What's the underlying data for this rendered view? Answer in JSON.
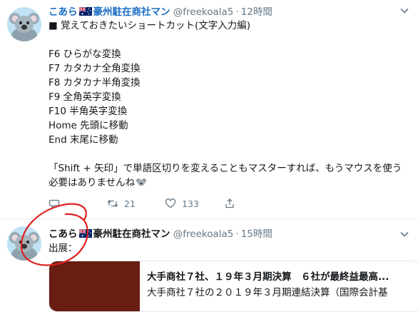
{
  "tweets": [
    {
      "name": "こあら",
      "name_suffix": "豪州駐在商社マン",
      "handle": "@freekoala5",
      "time": "12時間",
      "lines": [
        "■ 覚えておきたいショートカット(文字入力編)",
        "",
        "F6 ひらがな変換",
        "F7 カタカナ全角変換",
        "F8 カタカナ半角変換",
        "F9 全角英字変換",
        "F10 半角英字変換",
        "Home 先頭に移動",
        "End 末尾に移動",
        "",
        "「Shift + 矢印」で単語区切りを変えることもマスターすれば、もうマウスを使う",
        "必要はありませんね"
      ],
      "actions": {
        "reply": "",
        "retweets": "21",
        "likes": "133"
      }
    },
    {
      "name": "こあら",
      "name_suffix": "豪州駐在商社マン",
      "handle": "@freekoala5",
      "time": "15時間",
      "text": "出展：",
      "card": {
        "title": "大手商社７社、１９年３月期決算　６社が最終益最高...",
        "description": "大手商社７社の２０１９年３月期連結決算（国際会計基"
      }
    }
  ],
  "icons": {
    "flag": "australia-flag-icon",
    "emoji": "koala-emoji-icon",
    "reply": "reply-icon",
    "retweet": "retweet-icon",
    "like": "heart-icon",
    "share": "share-icon",
    "menu": "chevron-down-icon"
  },
  "colors": {
    "link_name": "#1b6ec2",
    "muted": "#657786",
    "annotation": "#e02020",
    "card_thumb": "#6a1d12"
  }
}
